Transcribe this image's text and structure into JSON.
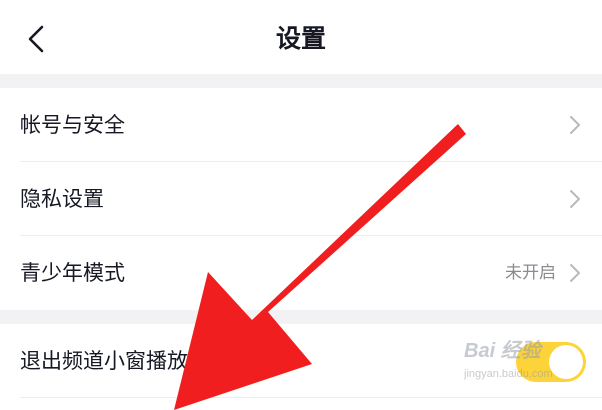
{
  "header": {
    "title": "设置",
    "back_icon": "chevron-left-icon"
  },
  "settings": {
    "items": [
      {
        "label": "帐号与安全",
        "value": "",
        "icon": "chevron-right-icon"
      },
      {
        "label": "隐私设置",
        "value": "",
        "icon": "chevron-right-icon"
      },
      {
        "label": "青少年模式",
        "value": "未开启",
        "icon": "chevron-right-icon"
      }
    ],
    "toggle_item": {
      "label": "退出频道小窗播放",
      "enabled": true
    }
  },
  "watermark": {
    "text": "Bai 经验",
    "subtext": "jingyan.baidu.com"
  },
  "colors": {
    "background": "#ffffff",
    "divider": "#f2f2f4",
    "text_primary": "#161823",
    "text_secondary": "#8a8b91",
    "toggle_on": "#fdd33a",
    "arrow": "#f01e1e"
  }
}
